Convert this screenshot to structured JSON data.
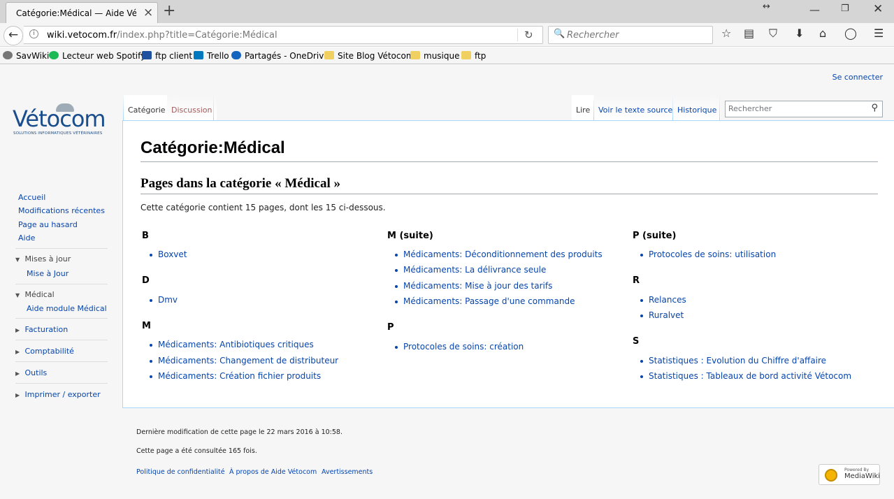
{
  "browser": {
    "tab_title": "Catégorie:Médical — Aide Vétocom",
    "url_domain": "wiki.vetocom.fr",
    "url_path": "/index.php?title=Catégorie:Médical",
    "search_placeholder": "Rechercher"
  },
  "bookmarks": [
    {
      "label": "SavWiki",
      "icon": "gear-icon"
    },
    {
      "label": "Lecteur web Spotify",
      "icon": "spotify-icon"
    },
    {
      "label": "ftp client",
      "icon": "computer-icon"
    },
    {
      "label": "Trello",
      "icon": "trello-icon"
    },
    {
      "label": "Partagés - OneDrive",
      "icon": "onedrive-icon"
    },
    {
      "label": "Site Blog Vétocom",
      "icon": "folder-icon"
    },
    {
      "label": "musique",
      "icon": "folder-icon"
    },
    {
      "label": "ftp",
      "icon": "folder-icon"
    }
  ],
  "wiki": {
    "login": "Se connecter",
    "logo_word": "Vétocom",
    "logo_tagline": "SOLUTIONS INFORMATIQUES VÉTÉRINAIRES",
    "nav": [
      "Accueil",
      "Modifications récentes",
      "Page au hasard",
      "Aide"
    ],
    "portals": [
      {
        "label": "Mises à jour",
        "expanded": true,
        "items": [
          "Mise à Jour"
        ]
      },
      {
        "label": "Médical",
        "expanded": true,
        "items": [
          "Aide module Médical"
        ]
      },
      {
        "label": "Facturation",
        "expanded": false,
        "items": []
      },
      {
        "label": "Comptabilité",
        "expanded": false,
        "items": []
      },
      {
        "label": "Outils",
        "expanded": false,
        "items": []
      },
      {
        "label": "Imprimer / exporter",
        "expanded": false,
        "items": []
      }
    ],
    "tabs_left": [
      "Catégorie",
      "Discussion"
    ],
    "tabs_right": [
      "Lire",
      "Voir le texte source",
      "Historique"
    ],
    "search_placeholder": "Rechercher",
    "title": "Catégorie:Médical",
    "subtitle": "Pages dans la catégorie « Médical »",
    "count_text": "Cette catégorie contient 15 pages, dont les 15 ci-dessous.",
    "columns": [
      [
        {
          "heading": "B",
          "items": [
            "Boxvet"
          ]
        },
        {
          "heading": "D",
          "items": [
            "Dmv"
          ]
        },
        {
          "heading": "M",
          "items": [
            "Médicaments: Antibiotiques critiques",
            "Médicaments: Changement de distributeur",
            "Médicaments: Création fichier produits"
          ]
        }
      ],
      [
        {
          "heading": "M (suite)",
          "items": [
            "Médicaments: Déconditionnement des produits",
            "Médicaments: La délivrance seule",
            "Médicaments: Mise à jour des tarifs",
            "Médicaments: Passage d'une commande"
          ]
        },
        {
          "heading": "P",
          "items": [
            "Protocoles de soins: création"
          ]
        }
      ],
      [
        {
          "heading": "P (suite)",
          "items": [
            "Protocoles de soins: utilisation"
          ]
        },
        {
          "heading": "R",
          "items": [
            "Relances",
            "Ruralvet"
          ]
        },
        {
          "heading": "S",
          "items": [
            "Statistiques : Evolution du Chiffre d'affaire",
            "Statistiques : Tableaux de bord activité Vétocom"
          ]
        }
      ]
    ],
    "footer": {
      "last_modified": "Dernière modification de cette page le 22 mars 2016 à 10:58.",
      "views": "Cette page a été consultée 165 fois.",
      "links": [
        "Politique de confidentialité",
        "À propos de Aide Vétocom",
        "Avertissements"
      ],
      "badge_top": "Powered By",
      "badge_bottom": "MediaWiki"
    }
  }
}
